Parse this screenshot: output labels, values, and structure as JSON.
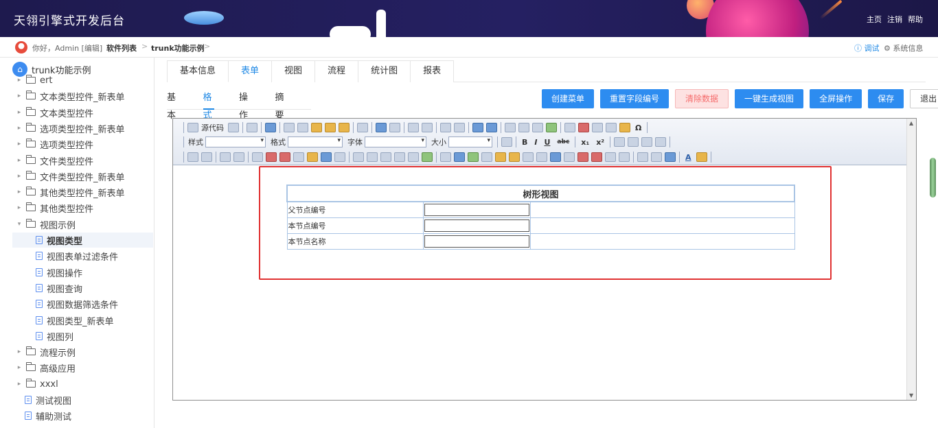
{
  "header": {
    "app_title": "天翎引擎式开发后台",
    "links": [
      "主页",
      "注销",
      "帮助"
    ]
  },
  "breadcrumb": {
    "greeting": "你好，Admin [编辑]",
    "items": [
      "软件列表",
      "trunk功能示例"
    ],
    "separator": ">",
    "debug": "ⓘ 调试",
    "sysinfo": "⚙ 系统信息"
  },
  "sidebar": {
    "root": "trunk功能示例",
    "items": [
      {
        "label": "ert",
        "type": "folder",
        "level": 0
      },
      {
        "label": "文本类型控件_新表单",
        "type": "folder",
        "level": 0
      },
      {
        "label": "文本类型控件",
        "type": "folder",
        "level": 0
      },
      {
        "label": "选项类型控件_新表单",
        "type": "folder",
        "level": 0
      },
      {
        "label": "选项类型控件",
        "type": "folder",
        "level": 0
      },
      {
        "label": "文件类型控件",
        "type": "folder",
        "level": 0
      },
      {
        "label": "文件类型控件_新表单",
        "type": "folder",
        "level": 0
      },
      {
        "label": "其他类型控件_新表单",
        "type": "folder",
        "level": 0
      },
      {
        "label": "其他类型控件",
        "type": "folder",
        "level": 0
      },
      {
        "label": "视图示例",
        "type": "folder-open",
        "level": 0
      },
      {
        "label": "视图类型",
        "type": "doc",
        "level": 1,
        "selected": true
      },
      {
        "label": "视图表单过滤条件",
        "type": "doc",
        "level": 1
      },
      {
        "label": "视图操作",
        "type": "doc",
        "level": 1
      },
      {
        "label": "视图查询",
        "type": "doc",
        "level": 1
      },
      {
        "label": "视图数据筛选条件",
        "type": "doc",
        "level": 1
      },
      {
        "label": "视图类型_新表单",
        "type": "doc",
        "level": 1
      },
      {
        "label": "视图列",
        "type": "doc",
        "level": 1
      },
      {
        "label": "流程示例",
        "type": "folder",
        "level": 0
      },
      {
        "label": "高级应用",
        "type": "folder",
        "level": 0
      },
      {
        "label": "xxxl",
        "type": "folder",
        "level": 0
      },
      {
        "label": "测试视图",
        "type": "doc",
        "level": 0
      },
      {
        "label": "辅助测试",
        "type": "doc",
        "level": 0
      }
    ]
  },
  "tabs_main": [
    "基本信息",
    "表单",
    "视图",
    "流程",
    "统计图",
    "报表"
  ],
  "tabs_main_active": 1,
  "tabs_sub": [
    "基本",
    "格式",
    "操作",
    "摘要"
  ],
  "tabs_sub_active": 1,
  "buttons": {
    "create_menu": "创建菜单",
    "reset_field_no": "重置字段编号",
    "clear_data": "清除数据",
    "gen_view": "一键生成视图",
    "fullscreen": "全屏操作",
    "save": "保存",
    "exit": "退出"
  },
  "editor": {
    "source_label": "源代码",
    "style_label": "样式",
    "format_label": "格式",
    "font_label": "字体",
    "size_label": "大小",
    "bold": "B",
    "italic": "I",
    "underline": "U",
    "strike": "abc",
    "subscript": "x₁",
    "superscript": "x²",
    "omega": "Ω",
    "font_color": "A",
    "form": {
      "caption": "树形视图",
      "rows": [
        {
          "label": "父节点编号",
          "value": ""
        },
        {
          "label": "本节点编号",
          "value": ""
        },
        {
          "label": "本节点名称",
          "value": ""
        }
      ]
    }
  }
}
